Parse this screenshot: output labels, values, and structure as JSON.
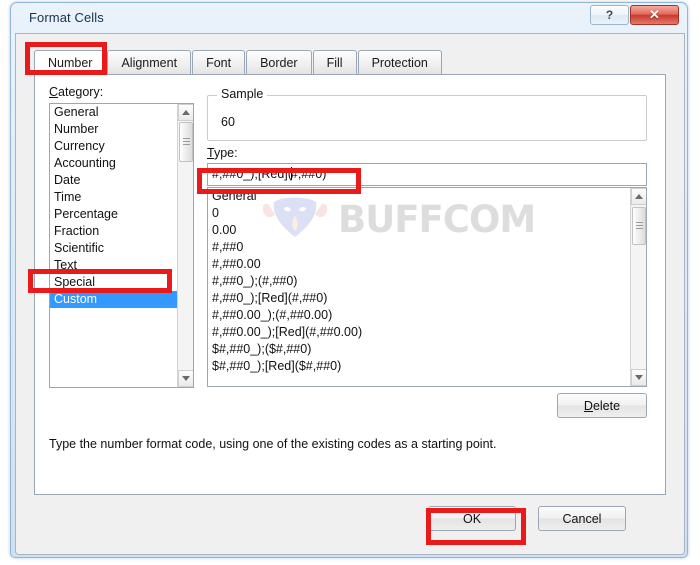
{
  "window": {
    "title": "Format Cells",
    "help_button": "?",
    "close_button": "✕"
  },
  "tabs": [
    {
      "label": "Number",
      "active": true
    },
    {
      "label": "Alignment",
      "active": false
    },
    {
      "label": "Font",
      "active": false
    },
    {
      "label": "Border",
      "active": false
    },
    {
      "label": "Fill",
      "active": false
    },
    {
      "label": "Protection",
      "active": false
    }
  ],
  "category": {
    "label": "Category:",
    "items": [
      "General",
      "Number",
      "Currency",
      "Accounting",
      "Date",
      "Time",
      "Percentage",
      "Fraction",
      "Scientific",
      "Text",
      "Special",
      "Custom"
    ],
    "selected": "Custom"
  },
  "sample": {
    "legend": "Sample",
    "value": "60"
  },
  "type": {
    "label": "Type:",
    "value_before_caret": "#,##0_);[Red](",
    "value_after_caret": "#,##0)",
    "full_value": "#,##0_);[Red](#,##0)",
    "items": [
      "General",
      "0",
      "0.00",
      "#,##0",
      "#,##0.00",
      "#,##0_);(#,##0)",
      "#,##0_);[Red](#,##0)",
      "#,##0.00_);(#,##0.00)",
      "#,##0.00_);[Red](#,##0.00)",
      "$#,##0_);($#,##0)",
      "$#,##0_);[Red]($#,##0)"
    ]
  },
  "buttons": {
    "delete": "Delete",
    "ok": "OK",
    "cancel": "Cancel"
  },
  "description": "Type the number format code, using one of the existing codes as a starting point.",
  "watermark": {
    "text": "BUFFCOM",
    "logo": "bull-head-logo"
  },
  "colors": {
    "annotation_red": "#e81a1a",
    "selection_blue": "#3399ff",
    "titlebar_blue": "#cfe0f2",
    "close_red": "#c9392c"
  }
}
